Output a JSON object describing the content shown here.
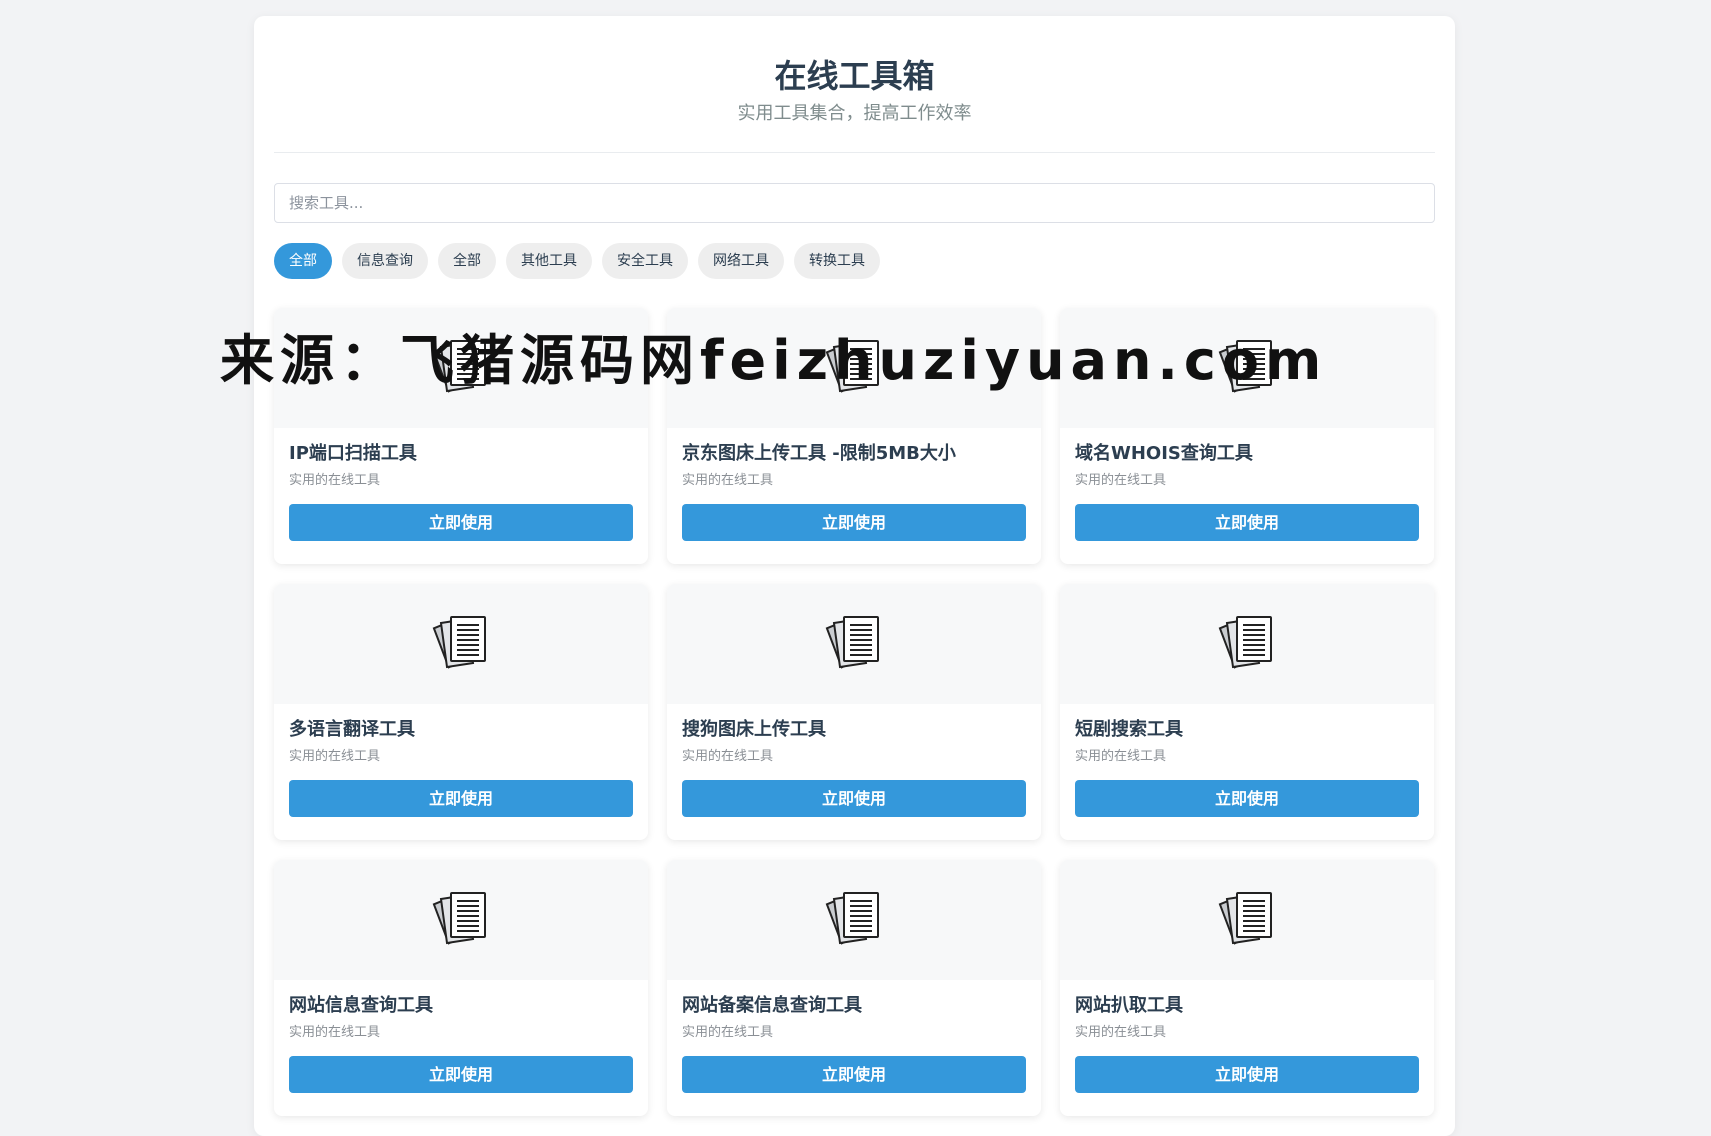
{
  "header": {
    "title": "在线工具箱",
    "subtitle": "实用工具集合，提高工作效率"
  },
  "search": {
    "placeholder": "搜索工具..."
  },
  "filters": [
    {
      "label": "全部",
      "active": true
    },
    {
      "label": "信息查询",
      "active": false
    },
    {
      "label": "全部",
      "active": false
    },
    {
      "label": "其他工具",
      "active": false
    },
    {
      "label": "安全工具",
      "active": false
    },
    {
      "label": "网络工具",
      "active": false
    },
    {
      "label": "转换工具",
      "active": false
    }
  ],
  "tools": [
    {
      "title": "IP端口扫描工具",
      "desc": "实用的在线工具",
      "button": "立即使用"
    },
    {
      "title": "京东图床上传工具 -限制5MB大小",
      "desc": "实用的在线工具",
      "button": "立即使用"
    },
    {
      "title": "域名WHOIS查询工具",
      "desc": "实用的在线工具",
      "button": "立即使用"
    },
    {
      "title": "多语言翻译工具",
      "desc": "实用的在线工具",
      "button": "立即使用"
    },
    {
      "title": "搜狗图床上传工具",
      "desc": "实用的在线工具",
      "button": "立即使用"
    },
    {
      "title": "短剧搜索工具",
      "desc": "实用的在线工具",
      "button": "立即使用"
    },
    {
      "title": "网站信息查询工具",
      "desc": "实用的在线工具",
      "button": "立即使用"
    },
    {
      "title": "网站备案信息查询工具",
      "desc": "实用的在线工具",
      "button": "立即使用"
    },
    {
      "title": "网站扒取工具",
      "desc": "实用的在线工具",
      "button": "立即使用"
    }
  ],
  "watermark": "来源：飞猪源码网feizhuziyuan.com",
  "colors": {
    "accent": "#3498db",
    "title_text": "#2c3e50"
  }
}
